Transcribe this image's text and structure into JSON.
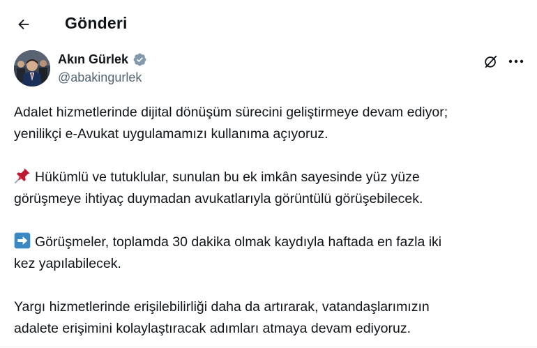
{
  "header": {
    "title": "Gönderi"
  },
  "author": {
    "name": "Akın Gürlek",
    "handle": "@abakingurlek"
  },
  "tweet": {
    "p1_line1": "Adalet hizmetlerinde dijital dönüşüm sürecini geliştirmeye devam ediyor;",
    "p1_line2": "yenilikçi e-Avukat uygulamamızı kullanıma açıyoruz.",
    "p2_line1": "Hükümlü ve tutuklular, sunulan bu ek imkân sayesinde yüz yüze",
    "p2_line2": "görüşmeye ihtiyaç duymadan avukatlarıyla görüntülü görüşebilecek.",
    "p3_line1": "Görüşmeler, toplamda 30 dakika olmak kaydıyla haftada en fazla iki",
    "p3_line2": "kez yapılabilecek.",
    "p4_line1": "Yargı hizmetlerinde erişilebilirliği daha da artırarak, vatandaşlarımızın",
    "p4_line2": "adalete erişimini kolaylaştıracak adımları atmaya devam ediyoruz."
  },
  "icons": {
    "back": "arrow-left-icon",
    "verified": "verified-badge-icon",
    "grok": "grok-icon",
    "more": "more-dots-icon",
    "pin": "pushpin-emoji-icon",
    "arrow_right": "right-arrow-emoji-icon"
  },
  "colors": {
    "text": "#0f1419",
    "secondary": "#536471",
    "verified": "#829aab",
    "emoji_arrow_bg": "#3b88c3",
    "emoji_pin": "#be1931"
  }
}
